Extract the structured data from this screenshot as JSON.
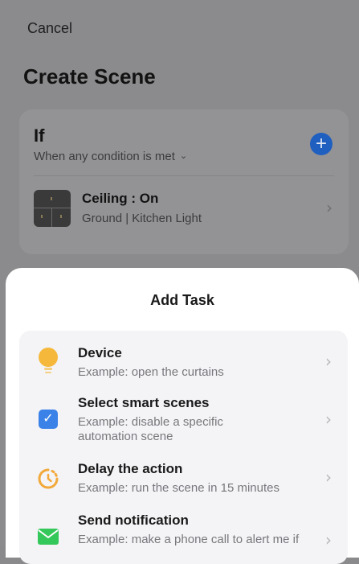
{
  "header": {
    "cancel_label": "Cancel",
    "title": "Create Scene"
  },
  "if_card": {
    "title": "If",
    "subtitle": "When any condition is met",
    "condition": {
      "title": "Ceiling : On",
      "subtitle": "Ground  | Kitchen Light"
    }
  },
  "sheet": {
    "title": "Add Task",
    "tasks": [
      {
        "title": "Device",
        "desc": "Example: open the curtains",
        "icon": "lightbulb-icon"
      },
      {
        "title": "Select smart scenes",
        "desc": "Example: disable a specific automation scene",
        "icon": "checkbox-icon"
      },
      {
        "title": "Delay the action",
        "desc": "Example: run the scene in 15 minutes",
        "icon": "timer-icon"
      },
      {
        "title": "Send notification",
        "desc": "Example: make a phone call to alert me if",
        "icon": "envelope-icon"
      }
    ]
  },
  "colors": {
    "accent_blue": "#3b82e8",
    "bulb_yellow": "#f5b83a",
    "timer_orange": "#f2a93b",
    "mail_green": "#34c759"
  }
}
